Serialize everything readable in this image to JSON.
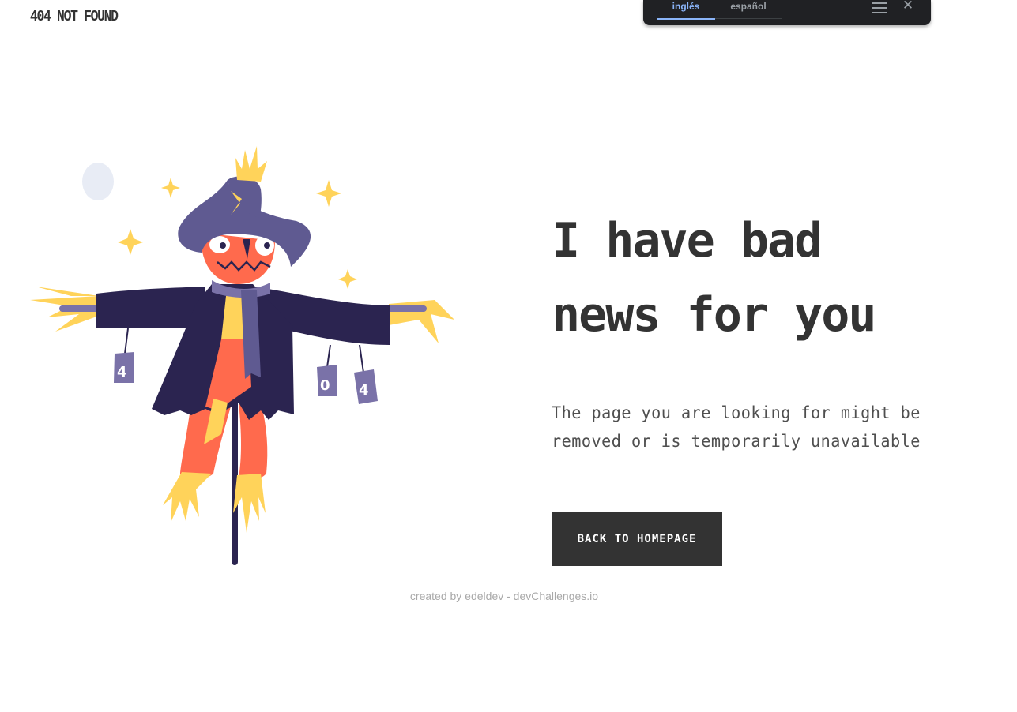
{
  "header": {
    "brand": "404 NOT FOUND"
  },
  "translate_bar": {
    "tabs": [
      {
        "label": "inglés",
        "active": true
      },
      {
        "label": "español",
        "active": false
      }
    ],
    "menu_icon": "hamburger-icon",
    "close_label": "✕"
  },
  "illustration": {
    "subject": "scarecrow",
    "cans": [
      "4",
      "0",
      "4"
    ],
    "colors": {
      "hat": "#5f5a91",
      "coat": "#2b2450",
      "face": "#ff6a4d",
      "straw": "#ffd35a",
      "can": "#7a72a8",
      "moon": "#e8ecf5"
    }
  },
  "main": {
    "heading_line1": "I have bad",
    "heading_line2": "news for you",
    "description_line1": "The page you are looking for might be",
    "description_line2": "removed or is temporarily unavailable",
    "button_label": "BACK TO HOMEPAGE"
  },
  "footer": {
    "credit": "created by edeldev - devChallenges.io"
  },
  "colors": {
    "text_dark": "#333333",
    "button_bg": "#333333",
    "button_text": "#ffffff",
    "footer_text": "#a9a9a9",
    "toolbar_bg": "#202124",
    "toolbar_active": "#8ab4f8"
  }
}
